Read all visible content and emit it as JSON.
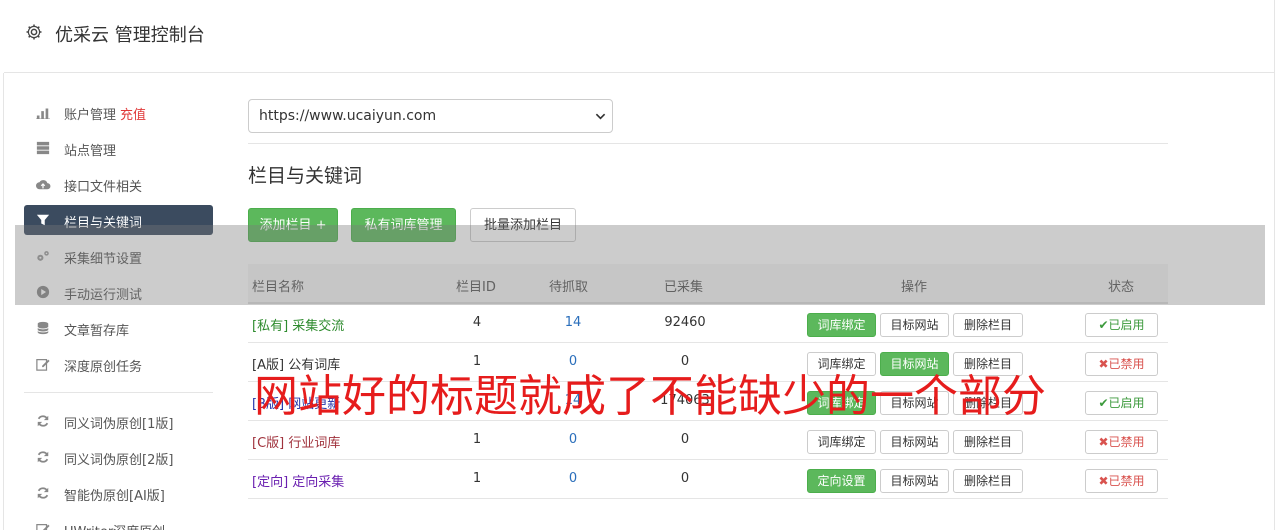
{
  "header": {
    "title": "优采云 管理控制台",
    "icon": "gear-icon"
  },
  "sidebar": {
    "items": [
      {
        "label": "账户管理",
        "extra": "充值",
        "icon": "bar-chart-icon",
        "active": false
      },
      {
        "label": "站点管理",
        "icon": "server-icon",
        "active": false
      },
      {
        "label": "接口文件相关",
        "icon": "cloud-upload-icon",
        "active": false
      },
      {
        "label": "栏目与关键词",
        "icon": "filter-icon",
        "active": true
      },
      {
        "label": "采集细节设置",
        "icon": "cogs-icon",
        "active": false
      },
      {
        "label": "手动运行测试",
        "icon": "play-circle-icon",
        "active": false
      },
      {
        "label": "文章暂存库",
        "icon": "database-icon",
        "active": false
      },
      {
        "label": "深度原创任务",
        "icon": "edit-icon",
        "active": false
      },
      {
        "label": "同义词伪原创[1版]",
        "icon": "refresh-icon",
        "active": false
      },
      {
        "label": "同义词伪原创[2版]",
        "icon": "refresh-icon",
        "active": false
      },
      {
        "label": "智能伪原创[AI版]",
        "icon": "refresh-icon",
        "active": false
      },
      {
        "label": "UWriter深度原创",
        "icon": "edit-icon",
        "active": false
      }
    ]
  },
  "main": {
    "site_select": {
      "value": "https://www.ucaiyun.com"
    },
    "section_title": "栏目与关键词",
    "buttons": {
      "add_column": "添加栏目 +",
      "private_lexicon": "私有词库管理",
      "batch_add": "批量添加栏目"
    },
    "table": {
      "headers": [
        "栏目名称",
        "栏目ID",
        "待抓取",
        "已采集",
        "操作",
        "状态"
      ],
      "rows": [
        {
          "tag": "[私有]",
          "name": "采集交流",
          "id": "4",
          "pending": "14",
          "collected": "92460",
          "btn1": "词库绑定",
          "btn1_style": "g",
          "btn2": "目标网站",
          "btn2_style": "w",
          "btn3": "删除栏目",
          "status": "已启用",
          "status_on": true,
          "color": "#2e8b2e"
        },
        {
          "tag": "[A版]",
          "name": "公有词库",
          "id": "1",
          "pending": "0",
          "collected": "0",
          "btn1": "词库绑定",
          "btn1_style": "w",
          "btn2": "目标网站",
          "btn2_style": "g",
          "btn3": "删除栏目",
          "status": "已禁用",
          "status_on": false,
          "color": "#333333"
        },
        {
          "tag": "[B版]",
          "name": "网站更新",
          "id": "",
          "pending": "14",
          "collected": "174063",
          "btn1": "词库绑定",
          "btn1_style": "g",
          "btn2": "目标网站",
          "btn2_style": "w",
          "btn3": "删除栏目",
          "status": "已启用",
          "status_on": true,
          "color": "#2233aa"
        },
        {
          "tag": "[C版]",
          "name": "行业词库",
          "id": "1",
          "pending": "0",
          "collected": "0",
          "btn1": "词库绑定",
          "btn1_style": "w",
          "btn2": "目标网站",
          "btn2_style": "w",
          "btn3": "删除栏目",
          "status": "已禁用",
          "status_on": false,
          "color": "#a0323c"
        },
        {
          "tag": "[定向]",
          "name": "定向采集",
          "id": "1",
          "pending": "0",
          "collected": "0",
          "btn1": "定向设置",
          "btn1_style": "g",
          "btn2": "目标网站",
          "btn2_style": "w",
          "btn3": "删除栏目",
          "status": "已禁用",
          "status_on": false,
          "color": "#6a1fb0"
        }
      ]
    }
  },
  "overlay": {
    "text": "网站好的标题就成了不能缺少的一个部分"
  },
  "colors": {
    "green": "#5cb85c",
    "active_nav": "#3b4b5f",
    "danger": "#d9534f",
    "watermark": "#e61c1c"
  }
}
